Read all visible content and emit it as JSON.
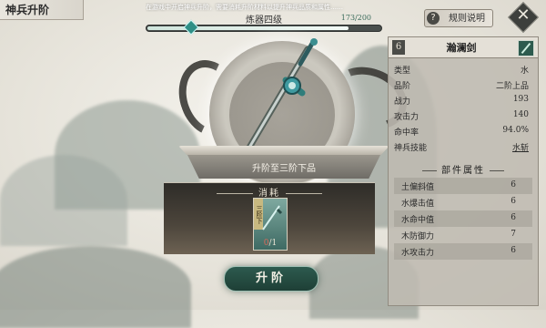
{
  "header": {
    "title": "神兵升阶",
    "notice": "在游戏中开启神兵升阶，需要消耗升阶材料以提升神兵品质和属性……",
    "rules_label": "规则说明"
  },
  "level": {
    "name": "炼器四级",
    "count": "173/200",
    "progress": 0.865
  },
  "center": {
    "upgrade_target": "升阶至三阶下品"
  },
  "cost": {
    "title": "消耗",
    "item_grade": "三阶下",
    "item_have": "0",
    "item_need": "/1"
  },
  "upgrade_button": "升阶",
  "weapon": {
    "grade_badge": "6",
    "name": "瀚澜剑",
    "stats": [
      {
        "k": "类型",
        "v": "水"
      },
      {
        "k": "品阶",
        "v": "二阶上品"
      },
      {
        "k": "战力",
        "v": "193"
      },
      {
        "k": "攻击力",
        "v": "140"
      },
      {
        "k": "命中率",
        "v": "94.0%"
      },
      {
        "k": "神兵技能",
        "v": "水斩"
      }
    ],
    "parts_title": "部件属性",
    "parts": [
      {
        "k": "土偏斜值",
        "v": "6"
      },
      {
        "k": "水爆击值",
        "v": "6"
      },
      {
        "k": "水命中值",
        "v": "6"
      },
      {
        "k": "木防御力",
        "v": "7"
      },
      {
        "k": "水攻击力",
        "v": "6"
      }
    ]
  },
  "icons": {
    "rules": "question-icon",
    "close": "close-icon",
    "weapon": "sword-icon"
  },
  "colors": {
    "accent": "#2d5a4e",
    "panel": "#bfbbb2",
    "warn": "#d96a5a"
  }
}
